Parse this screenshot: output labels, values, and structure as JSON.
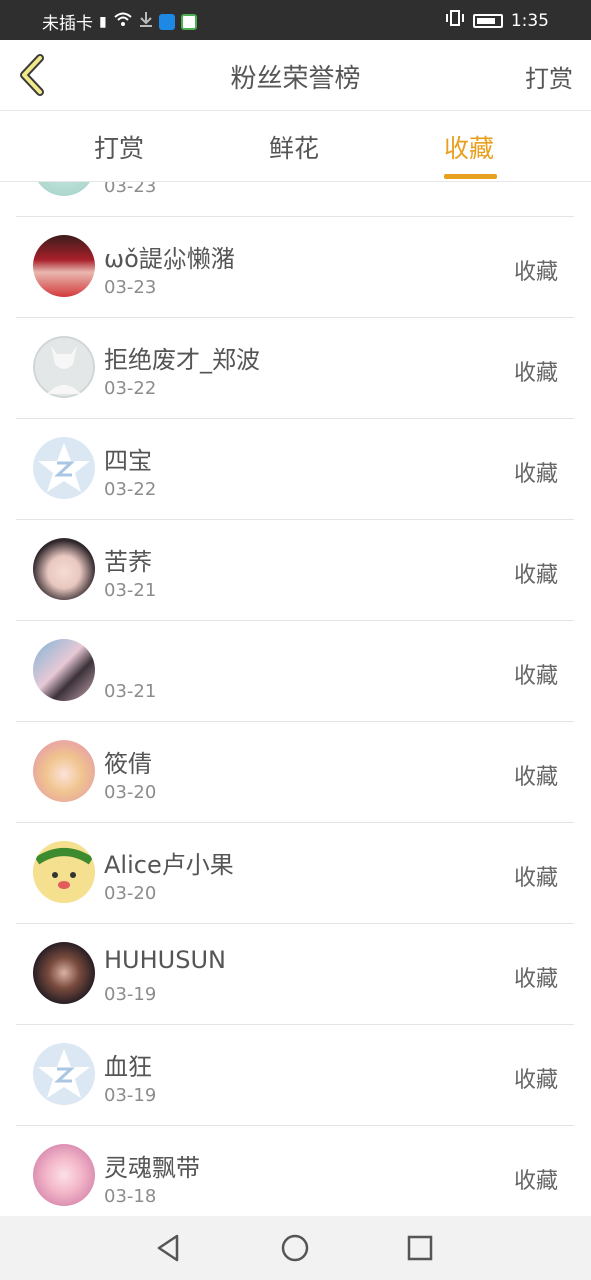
{
  "statusbar": {
    "carrier": "未插卡",
    "time": "1:35"
  },
  "header": {
    "title": "粉丝荣誉榜",
    "action_label": "打赏"
  },
  "tabs": [
    {
      "label": "打赏",
      "active": false
    },
    {
      "label": "鲜花",
      "active": false
    },
    {
      "label": "收藏",
      "active": true
    }
  ],
  "list": {
    "items": [
      {
        "name": "",
        "date": "03-23",
        "action": "",
        "avatar": "teal-photo"
      },
      {
        "name": "ωǒ諟尛懒潴",
        "date": "03-23",
        "action": "收藏",
        "avatar": "red-hair-photo"
      },
      {
        "name": "拒绝废才_郑波",
        "date": "03-22",
        "action": "收藏",
        "avatar": "default-silhouette"
      },
      {
        "name": "四宝",
        "date": "03-22",
        "action": "收藏",
        "avatar": "default-star"
      },
      {
        "name": "苦荞",
        "date": "03-21",
        "action": "收藏",
        "avatar": "portrait-photo"
      },
      {
        "name": "",
        "date": "03-21",
        "action": "收藏",
        "avatar": "couple-photo"
      },
      {
        "name": "筱倩",
        "date": "03-20",
        "action": "收藏",
        "avatar": "anime-girl"
      },
      {
        "name": "Alice卢小果",
        "date": "03-20",
        "action": "收藏",
        "avatar": "cartoon-wreath"
      },
      {
        "name": "HUHUSUN",
        "date": "03-19",
        "action": "收藏",
        "avatar": "dark-portrait"
      },
      {
        "name": "血狂",
        "date": "03-19",
        "action": "收藏",
        "avatar": "default-star"
      },
      {
        "name": "灵魂飘带",
        "date": "03-18",
        "action": "收藏",
        "avatar": "pink-anime"
      }
    ]
  },
  "colors": {
    "accent": "#e8a020",
    "statusbar_bg": "#2f2f2f",
    "navbar_bg": "#f2f2f2"
  }
}
